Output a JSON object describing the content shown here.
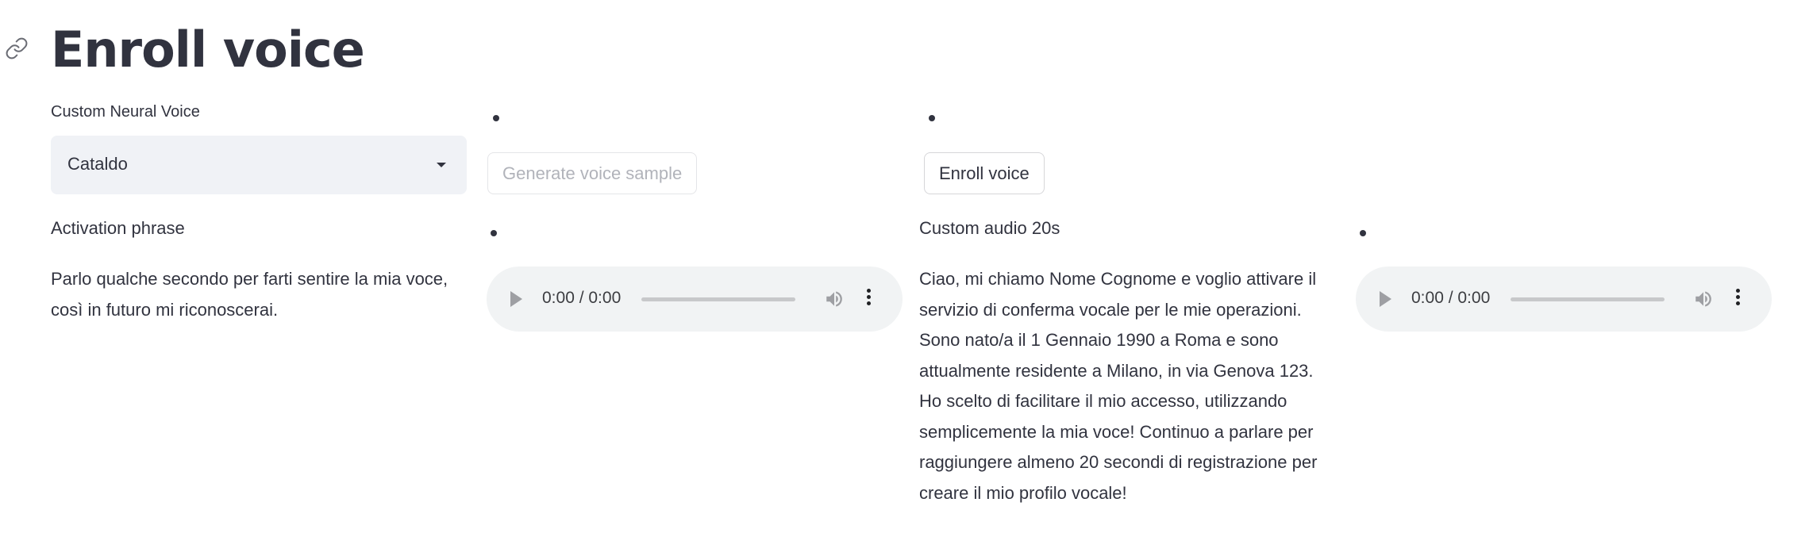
{
  "page": {
    "title": "Enroll voice"
  },
  "voice_select": {
    "label": "Custom Neural Voice",
    "value": "Cataldo"
  },
  "buttons": {
    "generate_sample": "Generate voice sample",
    "enroll": "Enroll voice"
  },
  "activation": {
    "label": "Activation phrase",
    "lines": [
      "Parlo qualche secondo per farti sentire la mia voce,",
      "così in futuro mi riconoscerai."
    ]
  },
  "custom_audio": {
    "label": "Custom audio 20s",
    "lines": [
      "Ciao, mi chiamo Nome Cognome e voglio attivare il",
      "servizio di conferma vocale per le mie operazioni.",
      "Sono nato/a il 1 Gennaio 1990 a Roma e sono",
      "attualmente residente a Milano, in via Genova 123.",
      "Ho scelto di facilitare il mio accesso, utilizzando",
      "semplicemente la mia voce! Continuo a parlare per",
      "raggiungere almeno 20 secondi di registrazione per",
      "creare il mio profilo vocale!"
    ]
  },
  "audio_players": [
    {
      "time": "0:00 / 0:00",
      "progress": 0
    },
    {
      "time": "0:00 / 0:00",
      "progress": 0
    }
  ],
  "icons": {
    "link": "link-icon",
    "caret": "chevron-down-icon",
    "play": "play-icon",
    "volume": "volume-icon",
    "more": "more-vertical-icon"
  },
  "colors": {
    "text": "#31333f",
    "select_bg": "#f0f2f6",
    "audio_bg": "#f1f3f4",
    "disabled_text": "#b1b3ba"
  }
}
